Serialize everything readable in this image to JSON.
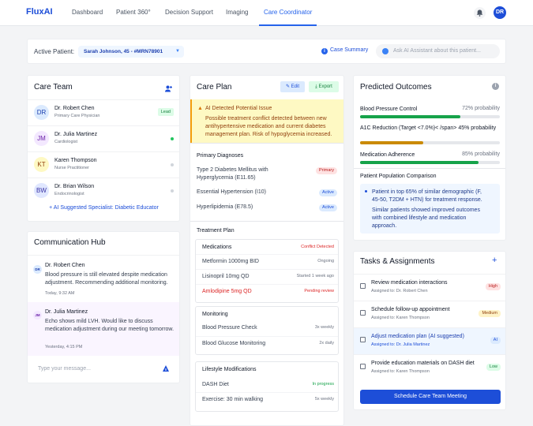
{
  "app": {
    "logo": "FluxAI",
    "avatar_initials": "DR"
  },
  "nav": [
    "Dashboard",
    "Patient 360°",
    "Decision Support",
    "Imaging",
    "Care Coordinator"
  ],
  "patient_bar": {
    "label": "Active Patient:",
    "patient": "Sarah Johnson, 45 - #MRN78901",
    "case_summary": "Case Summary",
    "ask_placeholder": "Ask AI Assistant about this patient..."
  },
  "care_team": {
    "title": "Care Team",
    "members": [
      {
        "initials": "DR",
        "name": "Dr. Robert Chen",
        "role": "Primary Care Physician",
        "badge": "Lead"
      },
      {
        "initials": "JM",
        "name": "Dr. Julia Martinez",
        "role": "Cardiologist"
      },
      {
        "initials": "KT",
        "name": "Karen Thompson",
        "role": "Nurse Practitioner"
      },
      {
        "initials": "BW",
        "name": "Dr. Brian Wilson",
        "role": "Endocrinologist"
      }
    ],
    "suggestion": "+ AI Suggested Specialist: Diabetic Educator"
  },
  "comm_hub": {
    "title": "Communication Hub",
    "messages": [
      {
        "initials": "DR",
        "name": "Dr. Robert Chen",
        "text": "Blood pressure is still elevated despite medication adjustment. Recommending additional monitoring.",
        "time": "Today, 9:32 AM"
      },
      {
        "initials": "JM",
        "name": "Dr. Julia Martinez",
        "text": "Echo shows mild LVH. Would like to discuss medication adjustment during our meeting tomorrow.",
        "time": "Yesterday, 4:15 PM"
      }
    ],
    "input_placeholder": "Type your message..."
  },
  "care_plan": {
    "title": "Care Plan",
    "edit": "Edit",
    "export": "Export",
    "alert_title": "AI Detected Potential Issue",
    "alert_text": "Possible treatment conflict detected between new antihypertensive medication and current diabetes management plan. Risk of hypoglycemia increased.",
    "diagnoses_title": "Primary Diagnoses",
    "diagnoses": [
      {
        "name": "Type 2 Diabetes Mellitus with Hyperglycemia (E11.65)",
        "status": "Primary"
      },
      {
        "name": "Essential Hypertension (I10)",
        "status": "Active"
      },
      {
        "name": "Hyperlipidemia (E78.5)",
        "status": "Active"
      }
    ],
    "treatment_title": "Treatment Plan",
    "medications": {
      "title": "Medications",
      "flag": "Conflict Detected",
      "items": [
        {
          "name": "Metformin 1000mg BID",
          "status": "Ongoing"
        },
        {
          "name": "Lisinopril 10mg QD",
          "status": "Started 1 week ago"
        },
        {
          "name": "Amlodipine 5mg QD",
          "status": "Pending review"
        }
      ]
    },
    "monitoring": {
      "title": "Monitoring",
      "items": [
        {
          "name": "Blood Pressure Check",
          "status": "3x weekly"
        },
        {
          "name": "Blood Glucose Monitoring",
          "status": "2x daily"
        }
      ]
    },
    "lifestyle": {
      "title": "Lifestyle Modifications",
      "items": [
        {
          "name": "DASH Diet",
          "status": "In progress"
        },
        {
          "name": "Exercise: 30 min walking",
          "status": "5x weekly"
        }
      ]
    }
  },
  "outcomes": {
    "title": "Predicted Outcomes",
    "items": [
      {
        "label": "Blood Pressure Control",
        "prob": "72% probability",
        "value": 0.72,
        "color": "#16a34a"
      },
      {
        "label": "A1C Reduction (Target <7.0%)< /span> 45% probability",
        "value": 0.45,
        "color": "#ca8a04"
      },
      {
        "label": "Medication Adherence",
        "prob": "85% probability",
        "value": 0.85,
        "color": "#16a34a"
      }
    ],
    "pop_title": "Patient Population Comparison",
    "pop_text1": "Patient in top 65% of similar demographic (F, 45-50, T2DM + HTN) for treatment response.",
    "pop_text2": "Similar patients showed improved outcomes with combined lifestyle and medication approach."
  },
  "tasks": {
    "title": "Tasks & Assignments",
    "items": [
      {
        "title": "Review medication interactions",
        "assigned": "Assigned to: Dr. Robert Chen",
        "priority": "High"
      },
      {
        "title": "Schedule follow-up appointment",
        "assigned": "Assigned to: Karen Thompson",
        "priority": "Medium"
      },
      {
        "title": "Adjust medication plan (AI suggested)",
        "assigned": "Assigned to: Dr. Julia Martinez",
        "priority": "AI"
      },
      {
        "title": "Provide education materials on DASH diet",
        "assigned": "Assigned to: Karen Thompson",
        "priority": "Low"
      }
    ],
    "button": "Schedule Care Team Meeting"
  }
}
